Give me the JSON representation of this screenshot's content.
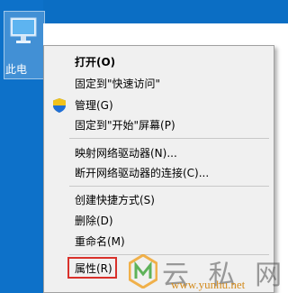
{
  "desktop": {
    "icon_label": "此电"
  },
  "menu": {
    "items": [
      {
        "label": "打开(O)"
      },
      {
        "label": "固定到\"快速访问\""
      },
      {
        "label": "管理(G)"
      },
      {
        "label": "固定到\"开始\"屏幕(P)"
      },
      {
        "label": "映射网络驱动器(N)..."
      },
      {
        "label": "断开网络驱动器的连接(C)..."
      },
      {
        "label": "创建快捷方式(S)"
      },
      {
        "label": "删除(D)"
      },
      {
        "label": "重命名(M)"
      },
      {
        "label": "属性(R)"
      }
    ],
    "highlight_color": "#d9312b"
  },
  "watermark": {
    "brand": "云 私 网",
    "url": "www.yunhu.net"
  },
  "icons": [
    "computer-icon",
    "shield-icon",
    "watermark-logo-icon"
  ]
}
